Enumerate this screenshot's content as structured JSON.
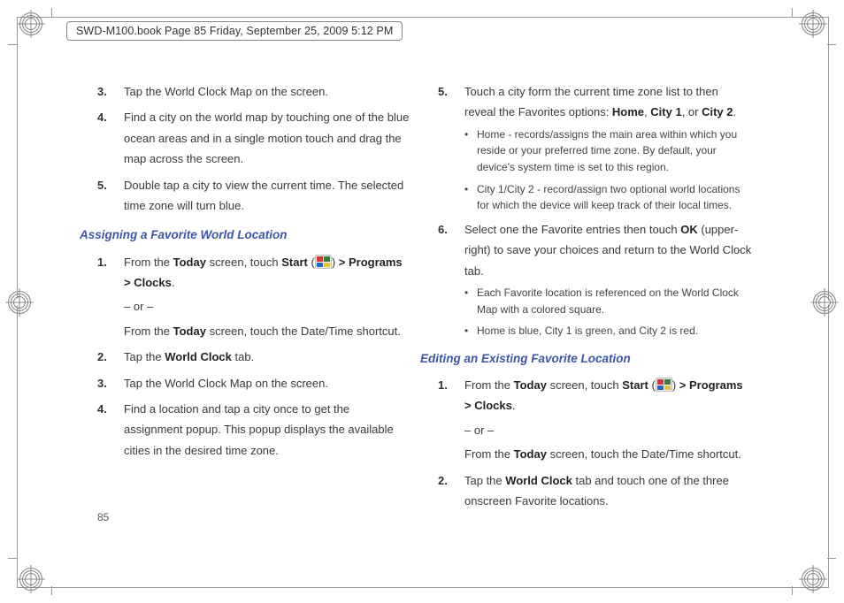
{
  "doc_header": "SWD-M100.book  Page 85  Friday, September 25, 2009  5:12 PM",
  "page_number": "85",
  "col1": {
    "steps_a": [
      "Tap the World Clock Map on the screen.",
      "Find a city on the world map by touching one of the blue ocean areas and in a single motion touch and drag the map across the screen.",
      "Double tap a city to view the current time. The selected time zone will turn blue."
    ],
    "heading_a": "Assigning a Favorite World Location",
    "s1_pre": "From the ",
    "s1_today": "Today",
    "s1_mid": " screen, touch ",
    "s1_start": "Start",
    "s1_open": " (",
    "s1_close": ") ",
    "s1_tail": "> Programs > Clocks",
    "s1_period": ".",
    "or": "– or –",
    "s1_alt_pre": "From the ",
    "s1_alt_today": "Today",
    "s1_alt_tail": " screen, touch the Date/Time shortcut.",
    "s2_pre": "Tap the ",
    "s2_b": "World Clock",
    "s2_tail": " tab.",
    "s3": "Tap the World Clock Map on the screen.",
    "s4": "Find a location and tap a city once to get the assignment popup. This popup displays the available cities in the desired time zone."
  },
  "col2": {
    "s5_pre": "Touch a city form the current time zone list to then reveal the Favorites options: ",
    "s5_b1": "Home",
    "s5_c1": ", ",
    "s5_b2": "City 1",
    "s5_c2": ", or ",
    "s5_b3": "City 2",
    "s5_period": ".",
    "sub5": [
      "Home - records/assigns the main area within which you reside or your preferred time zone. By default, your device's system time is set to this region.",
      "City 1/City 2 - record/assign two optional world locations for which the device will keep track of their local times."
    ],
    "s6_pre": "Select one the Favorite entries then touch ",
    "s6_b": "OK",
    "s6_tail": " (upper-right) to save your choices and return to the World Clock tab.",
    "sub6": [
      "Each Favorite location is referenced on the World Clock Map with a colored square.",
      "Home is blue, City 1 is green, and City 2 is red."
    ],
    "heading_b": "Editing an Existing Favorite Location",
    "e1_pre": "From the ",
    "e1_today": "Today",
    "e1_mid": " screen, touch ",
    "e1_start": "Start",
    "e1_open": " (",
    "e1_close": ") ",
    "e1_tail": "> Programs > Clocks",
    "e1_period": ".",
    "e1_alt_pre": "From the ",
    "e1_alt_today": "Today",
    "e1_alt_tail": " screen, touch the Date/Time shortcut.",
    "e2_pre": "Tap the ",
    "e2_b": "World Clock",
    "e2_tail": " tab and touch one of the three onscreen Favorite locations."
  }
}
